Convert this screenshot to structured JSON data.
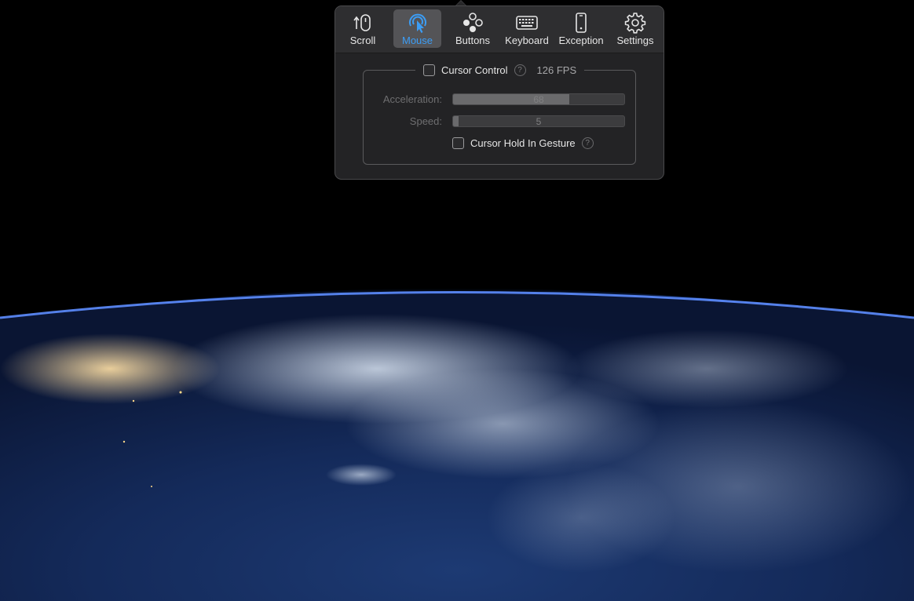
{
  "toolbar": {
    "tabs": [
      {
        "label": "Scroll",
        "icon": "scroll-icon",
        "active": false
      },
      {
        "label": "Mouse",
        "icon": "mouse-pointer-icon",
        "active": true
      },
      {
        "label": "Buttons",
        "icon": "buttons-icon",
        "active": false
      },
      {
        "label": "Keyboard",
        "icon": "keyboard-icon",
        "active": false
      },
      {
        "label": "Exception",
        "icon": "phone-icon",
        "active": false
      },
      {
        "label": "Settings",
        "icon": "gear-icon",
        "active": false
      }
    ]
  },
  "cursor_control": {
    "label": "Cursor Control",
    "checked": false,
    "help": "?",
    "fps": "126 FPS"
  },
  "acceleration": {
    "label": "Acceleration:",
    "value": "68",
    "fraction": 0.68
  },
  "speed": {
    "label": "Speed:",
    "value": "5",
    "fraction": 0.03
  },
  "cursor_hold": {
    "label": "Cursor Hold In Gesture",
    "checked": false,
    "help": "?"
  },
  "colors": {
    "accent": "#3c9df5",
    "popover_bg": "#232325",
    "toolbar_bg": "#2e2e30"
  },
  "wallpaper": "earth-from-orbit"
}
